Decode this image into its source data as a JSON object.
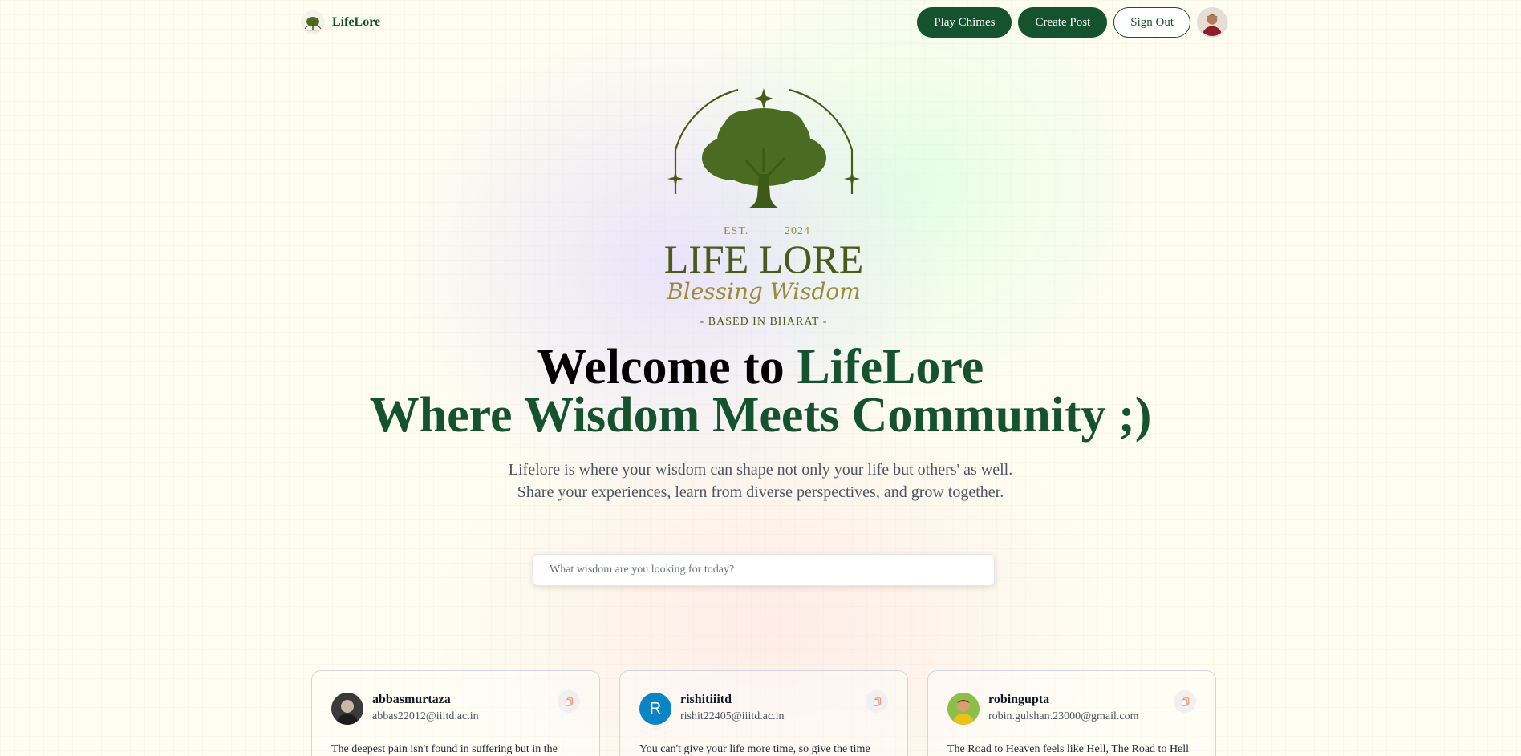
{
  "nav": {
    "brand": "LifeLore",
    "play_chimes": "Play Chimes",
    "create_post": "Create Post",
    "sign_out": "Sign Out"
  },
  "hero": {
    "logo": {
      "est": "EST.",
      "year": "2024",
      "title": "LIFE LORE",
      "script": "Blessing Wisdom",
      "based": "- BASED IN BHARAT -"
    },
    "headline_prefix": "Welcome to ",
    "headline_brand": "LifeLore",
    "headline_line2": "Where Wisdom Meets Community ;)",
    "sub_line1": "Lifelore is where your wisdom can shape not only your life but others' as well.",
    "sub_line2": "Share your experiences, learn from diverse perspectives, and grow together."
  },
  "search": {
    "placeholder": "What wisdom are you looking for today?",
    "value": ""
  },
  "posts": [
    {
      "username": "abbasmurtaza",
      "email": "abbas22012@iiitd.ac.in",
      "text": "The deepest pain isn't found in suffering but in the",
      "avatar_icon": "photo-avatar"
    },
    {
      "username": "rishitiiitd",
      "email": "rishit22405@iiitd.ac.in",
      "text": "You can't give your life more time, so give the time",
      "avatar_initial": "R"
    },
    {
      "username": "robingupta",
      "email": "robin.gulshan.23000@gmail.com",
      "text": "The Road to Heaven feels like Hell, The Road to Hell",
      "avatar_icon": "photo-avatar"
    }
  ],
  "colors": {
    "brand_green": "#14532d",
    "logo_olive": "#4b5a1b",
    "logo_gold": "#9a8a3c",
    "copy_icon": "#f08a6b",
    "initial_avatar_bg": "#0b84c6"
  }
}
